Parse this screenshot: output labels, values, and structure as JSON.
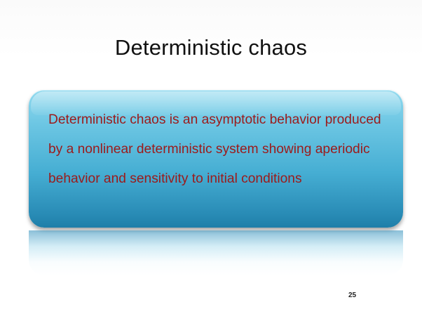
{
  "slide": {
    "title": "Deterministic chaos",
    "callout_text": "Deterministic chaos is an asymptotic behavior produced by a nonlinear deterministic system showing aperiodic behavior and sensitivity to initial conditions",
    "page_number": "25"
  },
  "colors": {
    "title": "#111111",
    "callout_text": "#9c1a1a",
    "callout_top": "#8fd9ee",
    "callout_bottom": "#1f7fa9"
  }
}
